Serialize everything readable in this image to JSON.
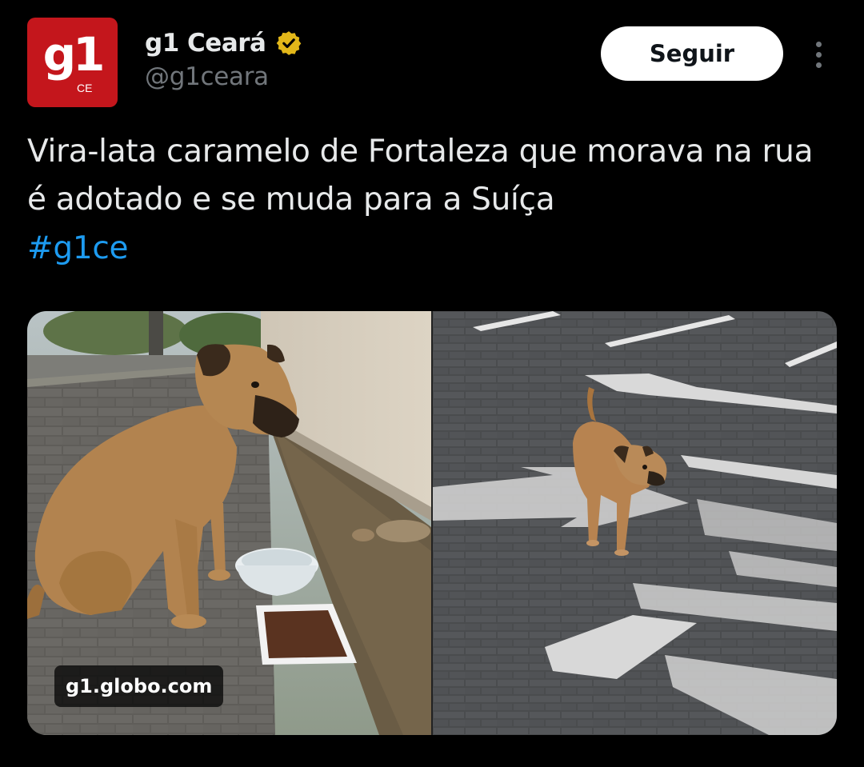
{
  "account": {
    "avatar_text": "g1",
    "avatar_subtext": "CE",
    "name": "g1 Ceará",
    "handle": "@g1ceara"
  },
  "actions": {
    "follow_label": "Seguir"
  },
  "post": {
    "text": "Vira-lata caramelo de Fortaleza que morava na rua é adotado e se muda para a Suíça",
    "hashtag": "#g1ce"
  },
  "media": {
    "watermark": "g1.globo.com"
  },
  "colors": {
    "background": "#000000",
    "text": "#e7e9ea",
    "secondary_text": "#71767b",
    "link": "#1d9bf0",
    "verified_badge": "#e2b719",
    "avatar_red": "#c4161c"
  },
  "icons": {
    "verified": "verified-badge-icon",
    "more": "more-options-icon"
  }
}
